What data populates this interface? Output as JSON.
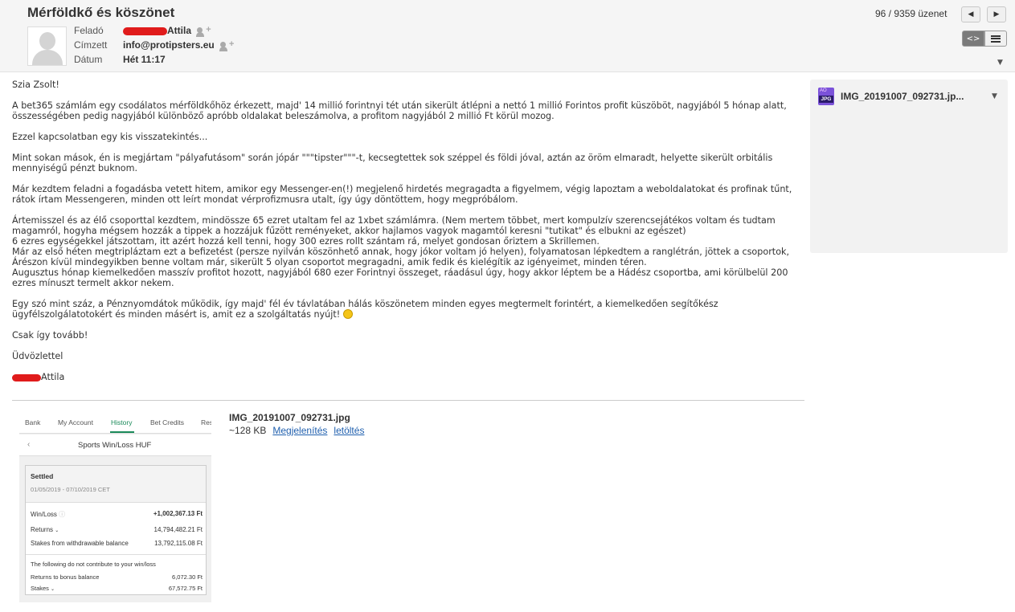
{
  "email": {
    "subject": "Mérföldkő és köszönet",
    "from_label": "Feladó",
    "from_name": "Attila",
    "to_label": "Címzett",
    "to_value": "info@protipsters.eu",
    "date_label": "Dátum",
    "date_value": "Hét 11:17"
  },
  "navigation": {
    "counter": "96 / 9359 üzenet"
  },
  "body": {
    "greeting": "Szia Zsolt!",
    "p1": "A bet365 számlám egy csodálatos mérföldkőhöz érkezett, majd' 14 millió forintnyi tét után sikerült átlépni a nettó 1 millió Forintos profit küszöböt, nagyjából 5 hónap alatt, összességében pedig nagyjából különböző apróbb oldalakat beleszámolva, a profitom nagyjából 2 millió Ft körül mozog.",
    "p2": "Ezzel kapcsolatban egy kis visszatekintés...",
    "p3": "Mint sokan mások, én is megjártam \"pályafutásom\" során jópár \"\"\"tipster\"\"\"-t, kecsegtettek sok széppel és földi jóval, aztán az öröm elmaradt, helyette sikerült orbitális mennyiségű pénzt buknom.",
    "p4": "Már kezdtem feladni a fogadásba vetett hitem, amikor egy Messenger-en(!) megjelenő hirdetés megragadta a figyelmem, végig lapoztam a weboldalatokat és profinak tűnt, rátok írtam Messengeren, minden ott leírt mondat vérprofizmusra utalt, így úgy döntöttem, hogy megpróbálom.",
    "p5a": "Ártemisszel és az élő csoporttal kezdtem, mindössze 65 ezret utaltam fel az 1xbet számlámra. (Nem mertem többet, mert kompulzív szerencsejátékos voltam és tudtam magamról, hogyha mégsem hozzák a tippek a hozzájuk fűzött reményeket, akkor hajlamos vagyok magamtól keresni \"tutikat\" és elbukni az egészet)",
    "p5b": "6 ezres egységekkel játszottam, itt azért hozzá kell tenni, hogy 300 ezres rollt szántam rá, melyet gondosan őriztem a Skrillemen.",
    "p5c": "Már az első héten megtripláztam ezt a befizetést (persze nyilván köszönhető annak, hogy jókor voltam jó helyen), folyamatosan lépkedtem a ranglétrán, jöttek a csoportok, Árészon kívül mindegyikben benne voltam már, sikerült 5 olyan csoportot megragadni, amik fedik és kielégítik az igényeimet, minden téren.",
    "p5d": "Augusztus hónap kiemelkedően masszív profitot hozott, nagyjából 680 ezer Forintnyi összeget, ráadásul úgy, hogy akkor léptem be a Hádész csoportba, ami körülbelül 200 ezres mínuszt termelt akkor nekem.",
    "p6": "Egy szó mint száz, a Pénznyomdátok működik, így majd' fél év távlatában hálás köszönetem minden egyes megtermelt forintért, a kiemelkedően segítőkész ügyfélszolgálatotokért és minden másért is, amit ez a szolgáltatás nyújt!",
    "p7": "Csak így tovább!",
    "p8": "Üdvözlettel",
    "signature": "Attila"
  },
  "attachment": {
    "name_short": "IMG_20191007_092731.jp...",
    "icon_top": "AO",
    "icon_label": "JPG",
    "filename": "IMG_20191007_092731.jpg",
    "size": "~128 KB",
    "view_link": "Megjelenítés",
    "download_link": "letöltés"
  },
  "thumbnail": {
    "tabs": [
      "Bank",
      "My Account",
      "History",
      "Bet Credits",
      "Res"
    ],
    "active_tab": "History",
    "title": "Sports Win/Loss HUF",
    "settled": "Settled",
    "date_range": "01/05/2019 - 07/10/2019 CET",
    "winloss_label": "Win/Loss",
    "winloss_value": "+1,002,367.13 Ft",
    "returns_label": "Returns",
    "returns_value": "14,794,482.21 Ft",
    "stakes_withdrawable_label": "Stakes from withdrawable balance",
    "stakes_withdrawable_value": "13,792,115.08 Ft",
    "note": "The following do not contribute to your win/loss",
    "returns_bonus_label": "Returns to bonus balance",
    "returns_bonus_value": "6,072.30 Ft",
    "stakes_label": "Stakes",
    "stakes_value": "67,572.75 Ft"
  }
}
